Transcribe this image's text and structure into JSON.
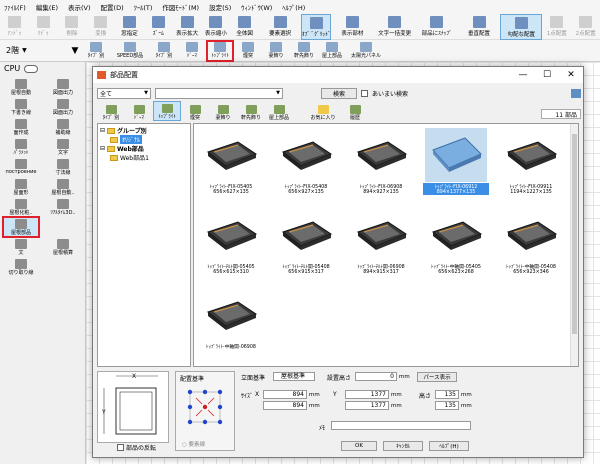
{
  "menu": [
    "ﾌｧｲﾙ(F)",
    "編集(E)",
    "表示(V)",
    "配置(D)",
    "ﾂｰﾙ(T)",
    "作図ﾓｰﾄﾞ(M)",
    "設定(S)",
    "ｳｨﾝﾄﾞｳ(W)",
    "ﾍﾙﾌﾟ(H)"
  ],
  "toolbar1": [
    {
      "label": "ｱﾝﾄﾞｩ",
      "icon": "undo-icon",
      "disabled": true
    },
    {
      "label": "ﾘﾄﾞｩ",
      "icon": "redo-icon",
      "disabled": true
    },
    {
      "label": "削除",
      "icon": "delete-icon",
      "disabled": true
    },
    {
      "label": "変換",
      "icon": "convert-icon",
      "disabled": true
    },
    {
      "label": "窓指定",
      "icon": "window-select-icon"
    },
    {
      "label": "ｽﾞｰﾑ",
      "icon": "zoom-icon"
    },
    {
      "label": "表示拡大",
      "icon": "zoom-in-icon"
    },
    {
      "label": "表示縮小",
      "icon": "zoom-out-icon"
    },
    {
      "label": "全体図",
      "icon": "overview-icon"
    },
    {
      "label": "要素選択",
      "icon": "select-element-icon",
      "wide": true
    },
    {
      "label": "ｵﾌﾞ ﾞｸﾞﾘｯﾄﾞ",
      "icon": "grid-icon",
      "active": true
    },
    {
      "label": "表示部材",
      "icon": "display-parts-icon",
      "wide": true
    },
    {
      "label": "文字一括変更",
      "icon": "text-change-icon",
      "wide": true
    },
    {
      "label": "部品にｽﾅｯﾌﾟ",
      "icon": "snap-icon",
      "wide": true
    },
    {
      "label": "垂直配置",
      "icon": "vertical-align-icon",
      "wide": true
    },
    {
      "label": "勾配な配置",
      "icon": "slope-place-icon",
      "wide": true,
      "active": true
    },
    {
      "label": "1点配置",
      "icon": "one-point-icon",
      "disabled": true
    },
    {
      "label": "2点配置",
      "icon": "two-point-icon",
      "disabled": true
    }
  ],
  "floor": {
    "label": "2階"
  },
  "toolbar2": [
    {
      "label": "ﾀｲﾌﾟ 別",
      "icon": "type-icon"
    },
    {
      "label": "SPEED部品",
      "icon": "speed-icon",
      "wide": true
    },
    {
      "label": "ﾀｲﾌﾟ 別",
      "icon": "type2-icon"
    },
    {
      "label": "ﾄﾞｰﾏ",
      "icon": "dormer-icon"
    },
    {
      "label": "ﾄｯﾌﾟﾗｲﾄ",
      "icon": "toplight-icon",
      "redbox": true
    },
    {
      "label": "煙突",
      "icon": "chimney-icon"
    },
    {
      "label": "妻飾り",
      "icon": "gable-icon"
    },
    {
      "label": "軒先飾り",
      "icon": "eave-icon"
    },
    {
      "label": "屋上部品",
      "icon": "roof-parts-icon"
    },
    {
      "label": "太陽光パネル",
      "icon": "solar-icon",
      "wide": true
    }
  ],
  "left_palette": {
    "cpu_label": "CPU",
    "items": [
      {
        "label": "屋根自動",
        "icon": "roof-auto-icon"
      },
      {
        "label": "図面出力",
        "icon": "drawing-out-icon"
      },
      {
        "label": "下書き線",
        "icon": "draft-line-icon"
      },
      {
        "label": "図面出力",
        "icon": "drawing-out2-icon"
      },
      {
        "label": "面作成",
        "icon": "face-create-icon"
      },
      {
        "label": "補助線",
        "icon": "aux-line-icon"
      },
      {
        "label": "ﾊﾟﾗﾒｯﾄ",
        "icon": "param-icon"
      },
      {
        "label": "文字",
        "icon": "text-icon"
      },
      {
        "label": "построение",
        "icon": "build-icon"
      },
      {
        "label": "寸法線",
        "icon": "dimension-icon"
      },
      {
        "label": "屋面形",
        "icon": "roof-shape-icon"
      },
      {
        "label": "屋根自動..",
        "icon": "roof-auto2-icon"
      },
      {
        "label": "屋根化粧..",
        "icon": "roof-finish-icon"
      },
      {
        "label": "ﾘｱﾙﾀｲﾑ3D..",
        "icon": "realtime3d-icon"
      },
      {
        "label": "面設定",
        "icon": "face-setting-icon"
      },
      {
        "label": "屋根部品",
        "icon": "roof-parts-icon",
        "selected": true
      },
      {
        "label": "文",
        "icon": "sentence-icon"
      },
      {
        "label": "屋根積算",
        "icon": "roof-estimate-icon"
      },
      {
        "label": "切り取り線",
        "icon": "cut-line-icon"
      }
    ]
  },
  "dialog": {
    "title": "部品配置",
    "filter_value": "全て",
    "category_value": "",
    "search_button": "検索",
    "fuzzy_label": "あいまい検索",
    "count": "11 部品",
    "tabs": [
      {
        "label": "ﾀｲﾌﾟ 別",
        "icon": "type-icon"
      },
      {
        "label": "ﾄﾞｰﾏ",
        "icon": "dormer-icon"
      },
      {
        "label": "ﾄｯﾌﾟﾗｲﾄ",
        "icon": "toplight-icon",
        "active": true
      },
      {
        "label": "煙突",
        "icon": "chimney-icon"
      },
      {
        "label": "妻飾り",
        "icon": "gable-icon"
      },
      {
        "label": "軒先飾り",
        "icon": "eave-icon"
      },
      {
        "label": "屋上部品",
        "icon": "roof-parts-icon"
      },
      {
        "label": "お気に入り",
        "icon": "favorite-icon"
      },
      {
        "label": "履歴",
        "icon": "history-icon"
      }
    ],
    "tree": [
      {
        "label": "グループ別",
        "level": 0,
        "bold": true
      },
      {
        "label": "ｵﾘｼﾞﾅﾙ",
        "level": 1,
        "selected": true
      },
      {
        "label": "Web部品",
        "level": 0,
        "bold": true
      },
      {
        "label": "Web部品1",
        "level": 1
      }
    ],
    "parts": [
      {
        "name": "ﾄｯﾌﾟﾗｲﾄ-FIX-05405",
        "dims": "656×627×135"
      },
      {
        "name": "ﾄｯﾌﾟﾗｲﾄ-FIX-05408",
        "dims": "656×927×135"
      },
      {
        "name": "ﾄｯﾌﾟﾗｲﾄ-FIX-06908",
        "dims": "894×927×135"
      },
      {
        "name": "ﾄｯﾌﾟﾗｲﾄ-FIX-06912",
        "dims": "894×1377×135",
        "selected": true
      },
      {
        "name": "ﾄｯﾌﾟﾗｲﾄ-FIX-09911",
        "dims": "1194×1227×135"
      },
      {
        "name": "ﾄｯﾌﾟﾗｲﾄ-ﾁﾙﾄ開-05405",
        "dims": "656×615×310"
      },
      {
        "name": "ﾄｯﾌﾟﾗｲﾄ-ﾁﾙﾄ開-05408",
        "dims": "656×915×317"
      },
      {
        "name": "ﾄｯﾌﾟﾗｲﾄ-ﾁﾙﾄ開-06908",
        "dims": "894×915×317"
      },
      {
        "name": "ﾄｯﾌﾟﾗｲﾄ-中軸開-05405",
        "dims": "656×623×268"
      },
      {
        "name": "ﾄｯﾌﾟﾗｲﾄ-中軸開-05408",
        "dims": "656×923×346"
      },
      {
        "name": "ﾄｯﾌﾟﾗｲﾄ-中軸開-06908",
        "dims": ""
      }
    ],
    "flip_label": "部品の反転",
    "anchor_title": "配置基準",
    "anchor_caption": "○ 要素線",
    "elevation_label": "立面基準",
    "elevation_value": "屋根基準",
    "install_height_label": "設置高さ",
    "install_height_value": "0",
    "unit_mm": "mm",
    "perse_button": "パース表示",
    "size_label": "ｻｲｽﾞ",
    "x_label": "X",
    "y_label": "Y",
    "height_label": "高さ",
    "x_value": "894",
    "x_value2": "894",
    "y_value": "1377",
    "y_value2": "1377",
    "h_value": "135",
    "h_value2": "135",
    "memo_label": "ﾒﾓ",
    "ok_button": "OK",
    "cancel_button": "ｷｬﾝｾﾙ",
    "help_button": "ﾍﾙﾌﾟ(H)"
  }
}
